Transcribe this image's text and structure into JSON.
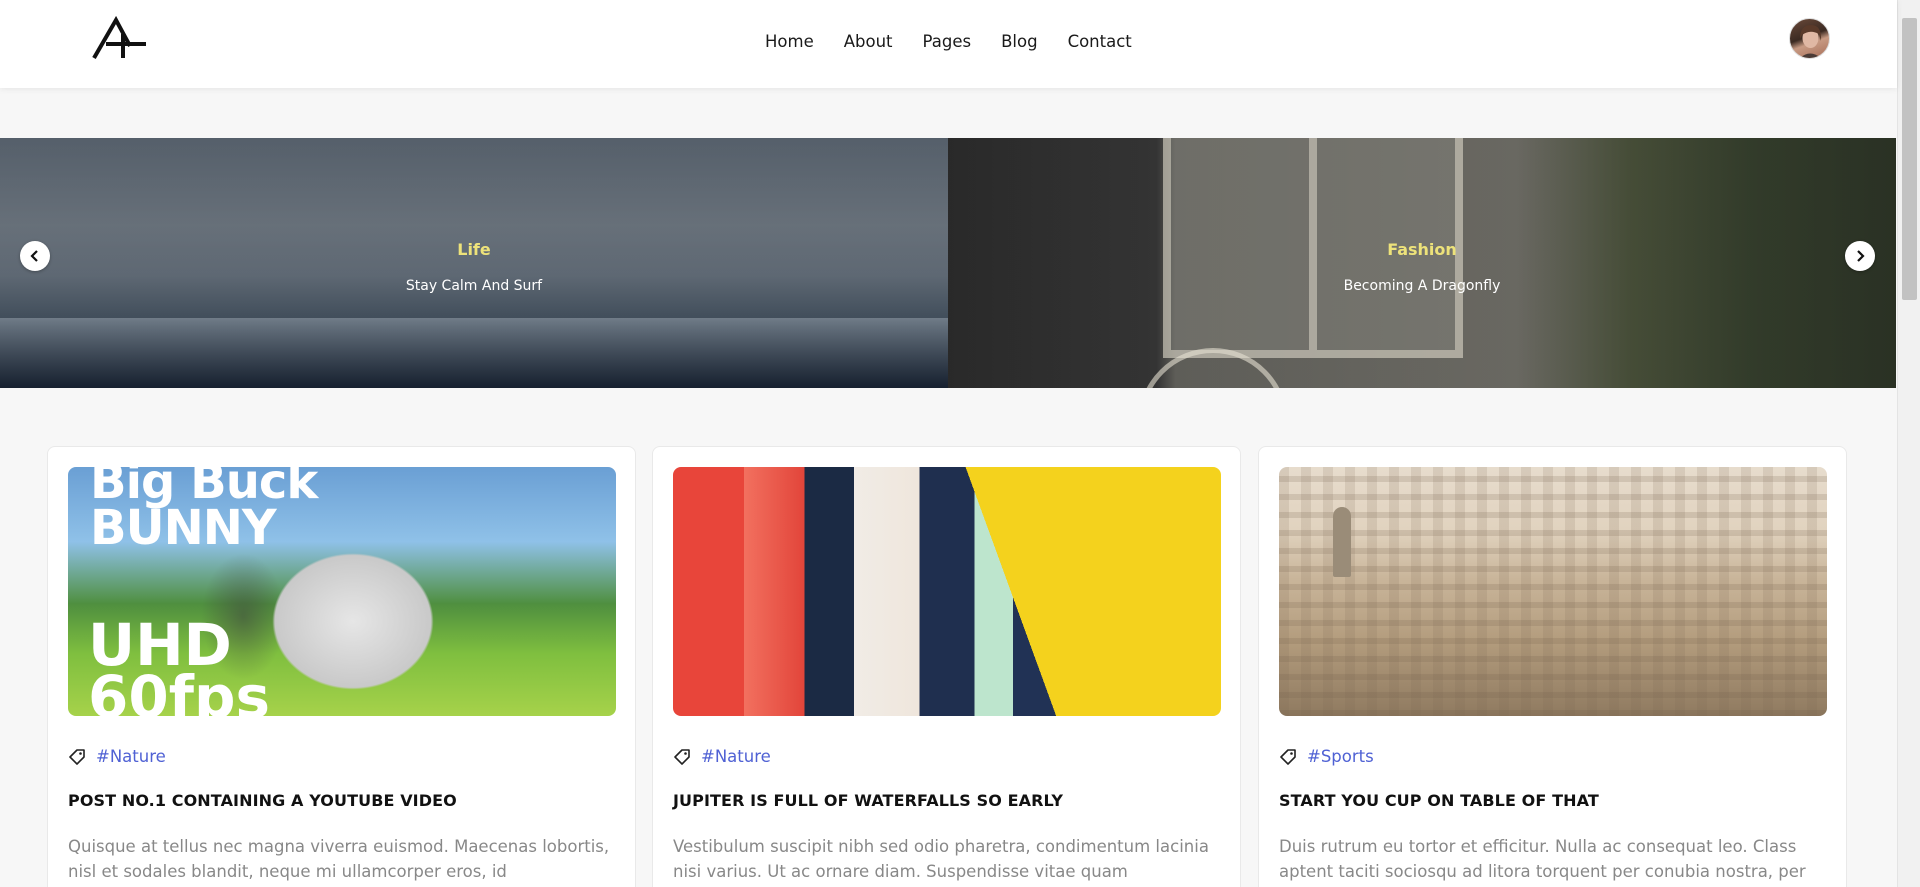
{
  "header": {
    "logo_alt": "A",
    "nav": [
      "Home",
      "About",
      "Pages",
      "Blog",
      "Contact"
    ]
  },
  "slider": {
    "slides": [
      {
        "category": "Life",
        "title": "Stay Calm And Surf"
      },
      {
        "category": "Fashion",
        "title": "Becoming A Dragonfly"
      }
    ],
    "prev_icon": "chevron-left-icon",
    "next_icon": "chevron-right-icon"
  },
  "posts": [
    {
      "image_caption_line1": "Big Buck",
      "image_caption_line2": "BUNNY",
      "image_caption_line3": "UHD",
      "image_caption_line4": "60fps",
      "tag": "#Nature",
      "title": "POST NO.1 CONTAINING A YOUTUBE VIDEO",
      "excerpt": "Quisque at tellus nec magna viverra euismod. Maecenas lobortis, nisl et sodales blandit, neque mi ullamcorper eros, id"
    },
    {
      "tag": "#Nature",
      "title": "JUPITER IS FULL OF WATERFALLS SO EARLY",
      "excerpt": "Vestibulum suscipit nibh sed odio pharetra, condimentum lacinia nisi varius. Ut ac ornare diam. Suspendisse vitae quam"
    },
    {
      "tag": "#Sports",
      "title": "START YOU CUP ON TABLE OF THAT",
      "excerpt": "Duis rutrum eu tortor et efficitur. Nulla ac consequat leo. Class aptent taciti sociosqu ad litora torquent per conubia nostra, per"
    }
  ],
  "colors": {
    "accent_tag": "#4f61d4",
    "slide_category": "#ede27a",
    "text_muted": "#888888"
  }
}
